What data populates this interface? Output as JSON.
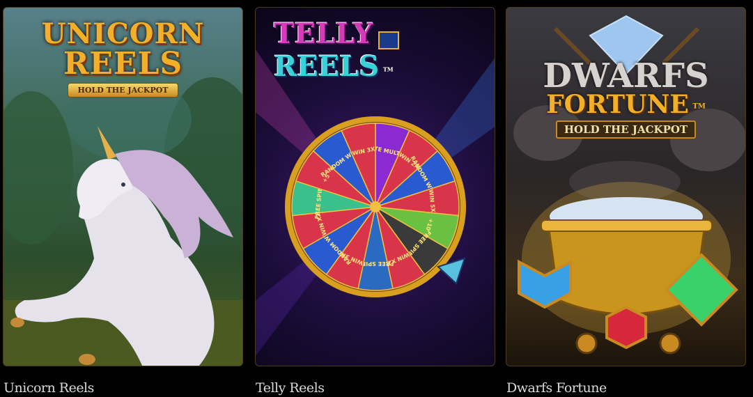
{
  "games": [
    {
      "title": "Unicorn Reels",
      "logo_line1": "UNICORN",
      "logo_line2": "REELS",
      "logo_ribbon": "HOLD THE JACKPOT"
    },
    {
      "title": "Telly Reels",
      "logo_line1": "TELLY",
      "logo_line2": "REELS",
      "logo_tm": "TM",
      "wheel_segments": [
        "INFINITE MULTIPLIER",
        "WIN 2X",
        "RANDOM WILDS",
        "WIN 5X",
        "+10",
        "FREE SPINS",
        "WIN X2",
        "FREE SPINS",
        "WIN 3X",
        "RANDOM WILDS",
        "WIN X2",
        "FREE SPINS",
        "+5",
        "RANDOM WILDS",
        "WIN 3X"
      ]
    },
    {
      "title": "Dwarfs Fortune",
      "logo_line1": "DWARFS",
      "logo_line2": "FORTUNE",
      "logo_tm": "TM",
      "logo_ribbon": "HOLD THE JACKPOT"
    }
  ],
  "colors": {
    "title_text": "#d9d9d9",
    "card_border": "#4a3a1e",
    "gold": "#f2b02a"
  }
}
